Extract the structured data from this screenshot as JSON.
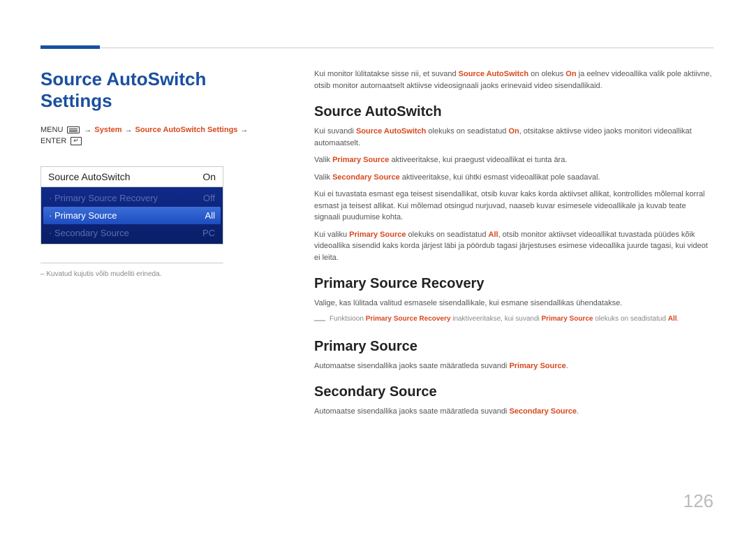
{
  "leftTitle": "Source AutoSwitch Settings",
  "breadcrumb": {
    "menu": "MENU",
    "arrow": "→",
    "system": "System",
    "settings": "Source AutoSwitch Settings",
    "enter": "ENTER"
  },
  "panel": {
    "headerLabel": "Source AutoSwitch",
    "headerValue": "On",
    "rows": [
      {
        "label": "· Primary Source Recovery",
        "value": "Off",
        "cls": "dim"
      },
      {
        "label": "· Primary Source",
        "value": "All",
        "cls": "sel"
      },
      {
        "label": "· Secondary Source",
        "value": "PC",
        "cls": "dim"
      }
    ]
  },
  "leftNote": "Kuvatud kujutis võib mudeliti erineda.",
  "intro": {
    "p1a": "Kui monitor lülitatakse sisse nii, et suvand ",
    "p1b": "Source AutoSwitch",
    "p1c": " on olekus ",
    "p1d": "On",
    "p1e": " ja eelnev videoallika valik pole aktiivne, otsib monitor automaatselt aktiivse videosignaali jaoks erinevaid video sisendallikaid."
  },
  "sec1": {
    "h": "Source AutoSwitch",
    "p1a": "Kui suvandi ",
    "p1b": "Source AutoSwitch",
    "p1c": " olekuks on seadistatud ",
    "p1d": "On",
    "p1e": ", otsitakse aktiivse video jaoks monitori videoallikat automaatselt.",
    "p2a": "Valik ",
    "p2b": "Primary Source",
    "p2c": " aktiveeritakse, kui praegust videoallikat ei tunta ära.",
    "p3a": "Valik ",
    "p3b": "Secondary Source",
    "p3c": " aktiveeritakse, kui ühtki esmast videoallikat pole saadaval.",
    "p4": "Kui ei tuvastata esmast ega teisest sisendallikat, otsib kuvar kaks korda aktiivset allikat, kontrollides mõlemal korral esmast ja teisest allikat. Kui mõlemad otsingud nurjuvad, naaseb kuvar esimesele videoallikale ja kuvab teate signaali puudumise kohta.",
    "p5a": "Kui valiku ",
    "p5b": "Primary Source",
    "p5c": " olekuks on seadistatud ",
    "p5d": "All",
    "p5e": ", otsib monitor aktiivset videoallikat tuvastada püüdes kõik videoallika sisendid kaks korda järjest läbi ja pöördub tagasi järjestuses esimese videoallika juurde tagasi, kui videot ei leita."
  },
  "sec2": {
    "h": "Primary Source Recovery",
    "p1": "Valige, kas lülitada valitud esmasele sisendallikale, kui esmane sisendallikas ühendatakse.",
    "noteA": "Funktsioon ",
    "noteB": "Primary Source Recovery",
    "noteC": " inaktiveeritakse, kui suvandi ",
    "noteD": "Primary Source",
    "noteE": " olekuks on seadistatud ",
    "noteF": "All",
    "noteG": "."
  },
  "sec3": {
    "h": "Primary Source",
    "p1a": "Automaatse sisendallika jaoks saate määratleda suvandi ",
    "p1b": "Primary Source",
    "p1c": "."
  },
  "sec4": {
    "h": "Secondary Source",
    "p1a": "Automaatse sisendallika jaoks saate määratleda suvandi ",
    "p1b": "Secondary Source",
    "p1c": "."
  },
  "pageNumber": "126"
}
